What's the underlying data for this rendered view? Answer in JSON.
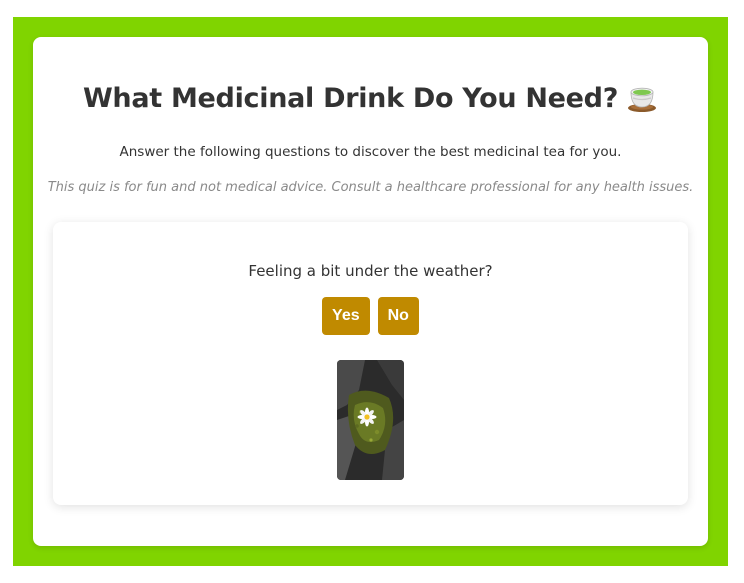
{
  "quiz": {
    "title": "What Medicinal Drink Do You Need?",
    "title_icon": "teacup-icon",
    "subtitle": "Answer the following questions to discover the best medicinal tea for you.",
    "disclaimer": "This quiz is for fun and not medical advice. Consult a healthcare professional for any health issues.",
    "question": "Feeling a bit under the weather?",
    "yes_label": "Yes",
    "no_label": "No",
    "image_subject": "daisy-flower-on-mossy-rock"
  },
  "colors": {
    "frame": "#80d400",
    "button": "#c08a00",
    "text": "#333333",
    "disclaimer": "#8a8a8a"
  }
}
